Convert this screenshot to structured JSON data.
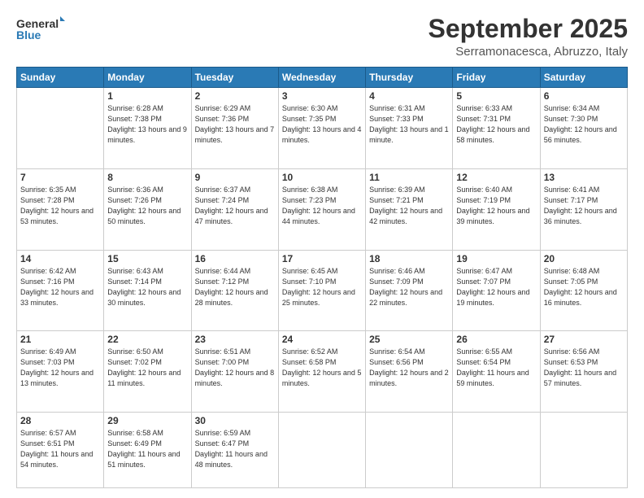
{
  "logo": {
    "line1": "General",
    "line2": "Blue"
  },
  "title": "September 2025",
  "location": "Serramonacesca, Abruzzo, Italy",
  "days_header": [
    "Sunday",
    "Monday",
    "Tuesday",
    "Wednesday",
    "Thursday",
    "Friday",
    "Saturday"
  ],
  "weeks": [
    [
      {
        "day": "",
        "sunrise": "",
        "sunset": "",
        "daylight": ""
      },
      {
        "day": "1",
        "sunrise": "Sunrise: 6:28 AM",
        "sunset": "Sunset: 7:38 PM",
        "daylight": "Daylight: 13 hours and 9 minutes."
      },
      {
        "day": "2",
        "sunrise": "Sunrise: 6:29 AM",
        "sunset": "Sunset: 7:36 PM",
        "daylight": "Daylight: 13 hours and 7 minutes."
      },
      {
        "day": "3",
        "sunrise": "Sunrise: 6:30 AM",
        "sunset": "Sunset: 7:35 PM",
        "daylight": "Daylight: 13 hours and 4 minutes."
      },
      {
        "day": "4",
        "sunrise": "Sunrise: 6:31 AM",
        "sunset": "Sunset: 7:33 PM",
        "daylight": "Daylight: 13 hours and 1 minute."
      },
      {
        "day": "5",
        "sunrise": "Sunrise: 6:33 AM",
        "sunset": "Sunset: 7:31 PM",
        "daylight": "Daylight: 12 hours and 58 minutes."
      },
      {
        "day": "6",
        "sunrise": "Sunrise: 6:34 AM",
        "sunset": "Sunset: 7:30 PM",
        "daylight": "Daylight: 12 hours and 56 minutes."
      }
    ],
    [
      {
        "day": "7",
        "sunrise": "Sunrise: 6:35 AM",
        "sunset": "Sunset: 7:28 PM",
        "daylight": "Daylight: 12 hours and 53 minutes."
      },
      {
        "day": "8",
        "sunrise": "Sunrise: 6:36 AM",
        "sunset": "Sunset: 7:26 PM",
        "daylight": "Daylight: 12 hours and 50 minutes."
      },
      {
        "day": "9",
        "sunrise": "Sunrise: 6:37 AM",
        "sunset": "Sunset: 7:24 PM",
        "daylight": "Daylight: 12 hours and 47 minutes."
      },
      {
        "day": "10",
        "sunrise": "Sunrise: 6:38 AM",
        "sunset": "Sunset: 7:23 PM",
        "daylight": "Daylight: 12 hours and 44 minutes."
      },
      {
        "day": "11",
        "sunrise": "Sunrise: 6:39 AM",
        "sunset": "Sunset: 7:21 PM",
        "daylight": "Daylight: 12 hours and 42 minutes."
      },
      {
        "day": "12",
        "sunrise": "Sunrise: 6:40 AM",
        "sunset": "Sunset: 7:19 PM",
        "daylight": "Daylight: 12 hours and 39 minutes."
      },
      {
        "day": "13",
        "sunrise": "Sunrise: 6:41 AM",
        "sunset": "Sunset: 7:17 PM",
        "daylight": "Daylight: 12 hours and 36 minutes."
      }
    ],
    [
      {
        "day": "14",
        "sunrise": "Sunrise: 6:42 AM",
        "sunset": "Sunset: 7:16 PM",
        "daylight": "Daylight: 12 hours and 33 minutes."
      },
      {
        "day": "15",
        "sunrise": "Sunrise: 6:43 AM",
        "sunset": "Sunset: 7:14 PM",
        "daylight": "Daylight: 12 hours and 30 minutes."
      },
      {
        "day": "16",
        "sunrise": "Sunrise: 6:44 AM",
        "sunset": "Sunset: 7:12 PM",
        "daylight": "Daylight: 12 hours and 28 minutes."
      },
      {
        "day": "17",
        "sunrise": "Sunrise: 6:45 AM",
        "sunset": "Sunset: 7:10 PM",
        "daylight": "Daylight: 12 hours and 25 minutes."
      },
      {
        "day": "18",
        "sunrise": "Sunrise: 6:46 AM",
        "sunset": "Sunset: 7:09 PM",
        "daylight": "Daylight: 12 hours and 22 minutes."
      },
      {
        "day": "19",
        "sunrise": "Sunrise: 6:47 AM",
        "sunset": "Sunset: 7:07 PM",
        "daylight": "Daylight: 12 hours and 19 minutes."
      },
      {
        "day": "20",
        "sunrise": "Sunrise: 6:48 AM",
        "sunset": "Sunset: 7:05 PM",
        "daylight": "Daylight: 12 hours and 16 minutes."
      }
    ],
    [
      {
        "day": "21",
        "sunrise": "Sunrise: 6:49 AM",
        "sunset": "Sunset: 7:03 PM",
        "daylight": "Daylight: 12 hours and 13 minutes."
      },
      {
        "day": "22",
        "sunrise": "Sunrise: 6:50 AM",
        "sunset": "Sunset: 7:02 PM",
        "daylight": "Daylight: 12 hours and 11 minutes."
      },
      {
        "day": "23",
        "sunrise": "Sunrise: 6:51 AM",
        "sunset": "Sunset: 7:00 PM",
        "daylight": "Daylight: 12 hours and 8 minutes."
      },
      {
        "day": "24",
        "sunrise": "Sunrise: 6:52 AM",
        "sunset": "Sunset: 6:58 PM",
        "daylight": "Daylight: 12 hours and 5 minutes."
      },
      {
        "day": "25",
        "sunrise": "Sunrise: 6:54 AM",
        "sunset": "Sunset: 6:56 PM",
        "daylight": "Daylight: 12 hours and 2 minutes."
      },
      {
        "day": "26",
        "sunrise": "Sunrise: 6:55 AM",
        "sunset": "Sunset: 6:54 PM",
        "daylight": "Daylight: 11 hours and 59 minutes."
      },
      {
        "day": "27",
        "sunrise": "Sunrise: 6:56 AM",
        "sunset": "Sunset: 6:53 PM",
        "daylight": "Daylight: 11 hours and 57 minutes."
      }
    ],
    [
      {
        "day": "28",
        "sunrise": "Sunrise: 6:57 AM",
        "sunset": "Sunset: 6:51 PM",
        "daylight": "Daylight: 11 hours and 54 minutes."
      },
      {
        "day": "29",
        "sunrise": "Sunrise: 6:58 AM",
        "sunset": "Sunset: 6:49 PM",
        "daylight": "Daylight: 11 hours and 51 minutes."
      },
      {
        "day": "30",
        "sunrise": "Sunrise: 6:59 AM",
        "sunset": "Sunset: 6:47 PM",
        "daylight": "Daylight: 11 hours and 48 minutes."
      },
      {
        "day": "",
        "sunrise": "",
        "sunset": "",
        "daylight": ""
      },
      {
        "day": "",
        "sunrise": "",
        "sunset": "",
        "daylight": ""
      },
      {
        "day": "",
        "sunrise": "",
        "sunset": "",
        "daylight": ""
      },
      {
        "day": "",
        "sunrise": "",
        "sunset": "",
        "daylight": ""
      }
    ]
  ]
}
